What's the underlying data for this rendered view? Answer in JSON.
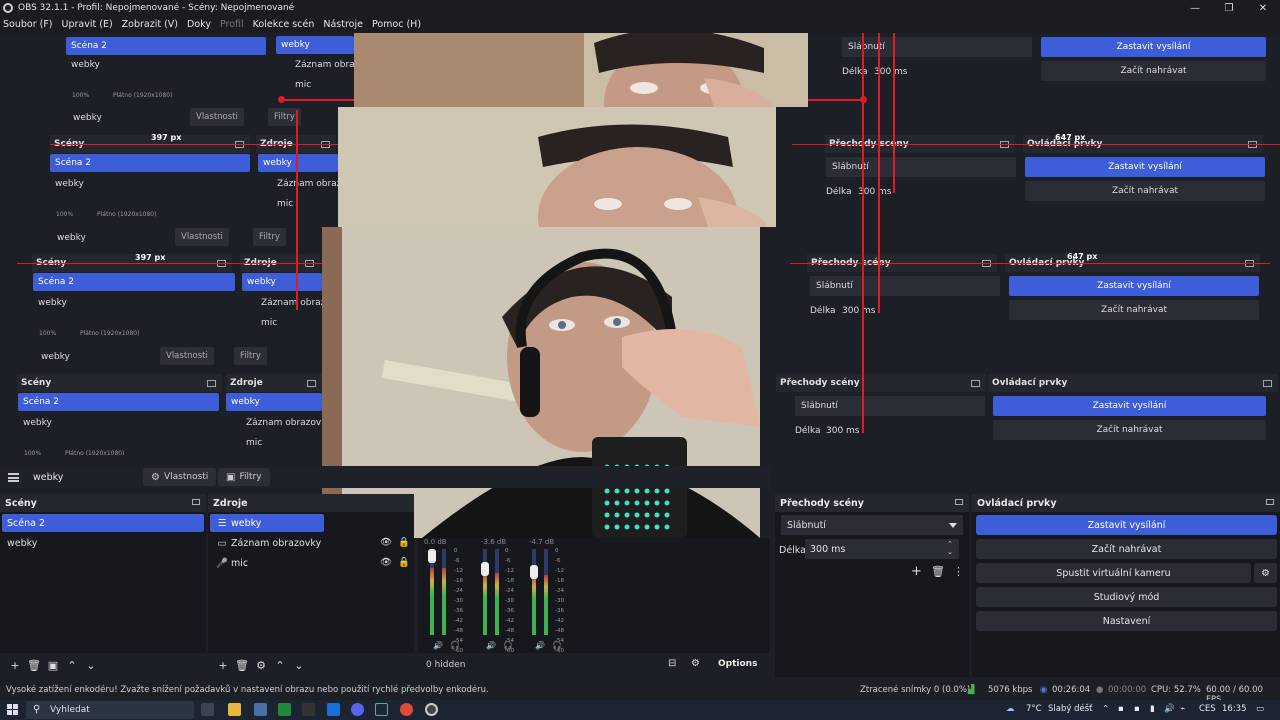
{
  "window": {
    "title": "OBS 32.1.1 - Profil: Nepojmenované - Scény: Nepojmenované",
    "controls": [
      "—",
      "❐",
      "✕"
    ]
  },
  "menu": [
    "Soubor (F)",
    "Upravit (E)",
    "Zobrazit (V)",
    "Doky",
    "Profil",
    "Kolekce scén",
    "Nástroje",
    "Pomoc (H)"
  ],
  "ghost": {
    "scenes_title": "Scény",
    "sources_title": "Zdroje",
    "transitions_title": "Přechody scény",
    "controls_title": "Ovládací prvky",
    "scene_selected": "Scéna 2",
    "scene_other": "webky",
    "source_webky": "webky",
    "source_screen": "Záznam obrazovky",
    "source_screen_clip": "Záznam obrazc",
    "source_mic": "mic",
    "props": "Vlastnosti",
    "filters": "Filtry",
    "transition": "Slábnutí",
    "duration_label": "Délka",
    "duration": "300 ms",
    "stop_stream": "Zastavit vysílání",
    "start_record": "Začít nahrávat",
    "zoom": "100%",
    "canvas": "Plátno (1920x1080)",
    "px_left": "397 px",
    "px_right": "647 px"
  },
  "scene_toolbar": {
    "scene_name": "webky",
    "properties": "Vlastnosti",
    "filters": "Filtry"
  },
  "scenes": {
    "title": "Scény",
    "items": [
      "Scéna 2",
      "webky"
    ],
    "selected": 0
  },
  "sources": {
    "title": "Zdroje",
    "items": [
      {
        "name": "webky",
        "icon": "list-icon"
      },
      {
        "name": "Záznam obrazovky",
        "icon": "monitor-icon"
      },
      {
        "name": "mic",
        "icon": "microphone-icon"
      }
    ]
  },
  "mixer": {
    "channels": [
      {
        "db": "0.0 dB",
        "level": 0.78
      },
      {
        "db": "-3.6 dB",
        "level": 0.72
      },
      {
        "db": "-4.7 dB",
        "level": 0.7
      }
    ],
    "scale": [
      "0",
      "-6",
      "-12",
      "-18",
      "-24",
      "-30",
      "-36",
      "-42",
      "-48",
      "-54",
      "-60"
    ],
    "hidden_count": "0 hidden",
    "options": "Options"
  },
  "transitions": {
    "title": "Přechody scény",
    "selected": "Slábnutí",
    "duration_label": "Délka",
    "duration": "300 ms"
  },
  "controls": {
    "title": "Ovládací prvky",
    "stop_stream": "Zastavit vysílání",
    "start_record": "Začít nahrávat",
    "virtual_cam": "Spustit virtuální kameru",
    "studio_mode": "Studiový mód",
    "settings": "Nastavení"
  },
  "status": {
    "warning": "Vysoké zatížení enkodéru! Zvažte snížení požadavků v nastavení obrazu nebo použití rychlé předvolby enkodéru.",
    "dropped": "Ztracené snímky 0 (0.0%)",
    "bitrate": "5076 kbps",
    "stream_time": "00:26:04",
    "record_time": "00:00:00",
    "cpu": "CPU: 52.7%",
    "fps": "60.00 / 60.00 FPS"
  },
  "taskbar": {
    "search": "Vyhledat",
    "weather": "7°C",
    "weather_desc": "Slabý déšť",
    "lang": "CES",
    "time": "16:35"
  },
  "colors": {
    "accent": "#3e5dd8",
    "guide_red": "#e01b24",
    "dark_bg": "#1d1f26"
  }
}
